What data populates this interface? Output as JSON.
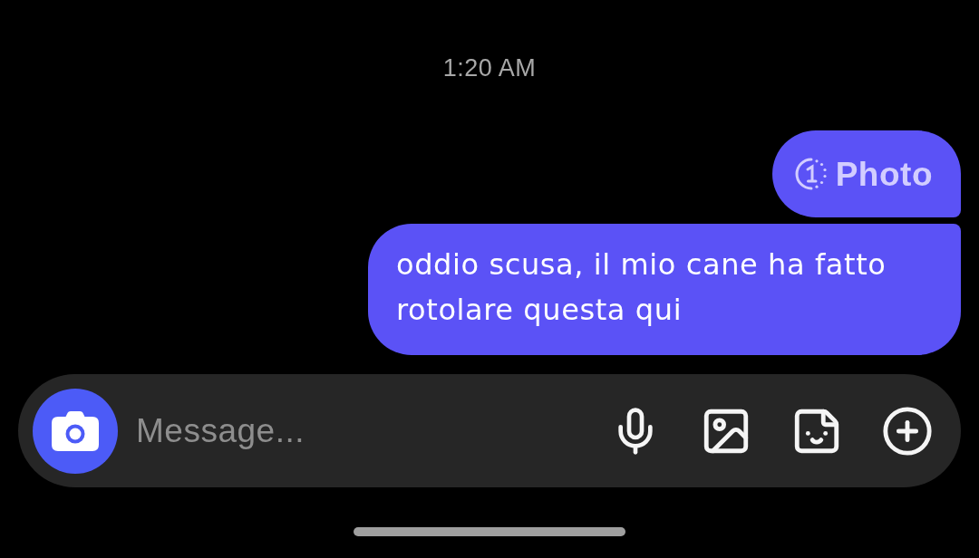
{
  "timestamp": "1:20 AM",
  "messages": [
    {
      "kind": "photo",
      "label": "Photo"
    },
    {
      "kind": "text",
      "text": "oddio scusa, il mio cane ha fatto rotolare questa qui"
    }
  ],
  "composer": {
    "placeholder": "Message..."
  }
}
